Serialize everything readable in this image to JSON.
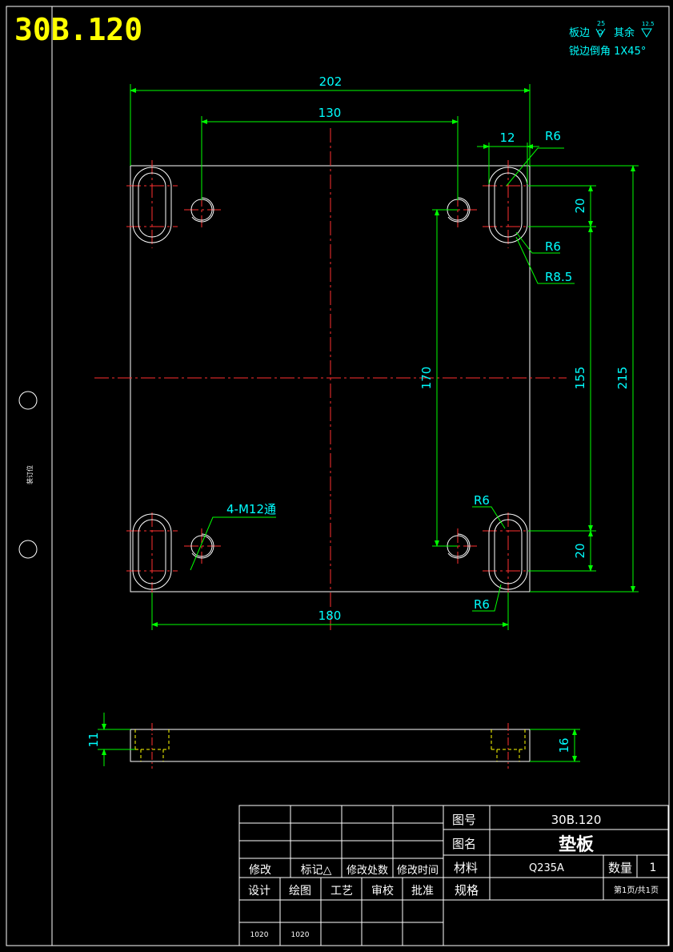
{
  "drawing": {
    "code_large": "30B.120",
    "note_line1_a": "板边",
    "note_line1_sym_a": "25",
    "note_line1_b": "其余",
    "note_line1_sym_b": "12.5",
    "note_line2": "锐边倒角 1X45°",
    "binding_label": "装订位"
  },
  "dimensions": {
    "d202": "202",
    "d130": "130",
    "d12": "12",
    "r6_top": "R6",
    "d20_top": "20",
    "r6_mid": "R6",
    "r85": "R8.5",
    "d170": "170",
    "d155": "155",
    "d215": "215",
    "r6_low": "R6",
    "d20_low": "20",
    "r6_bot": "R6",
    "d180": "180",
    "holes": "4-M12通",
    "d11": "11",
    "d16": "16"
  },
  "title_block": {
    "rev_headers": [
      "修改",
      "标记△",
      "修改处数",
      "修改时间"
    ],
    "sign_headers": [
      "设计",
      "绘图",
      "工艺",
      "审校",
      "批准"
    ],
    "sign_values": [
      "1020",
      "1020"
    ],
    "drawing_no_label": "图号",
    "drawing_no": "30B.120",
    "name_label": "图名",
    "name": "垫板",
    "material_label": "材料",
    "material": "Q235A",
    "qty_label": "数量",
    "qty": "1",
    "spec_label": "规格",
    "page": "第1页/共1页"
  }
}
